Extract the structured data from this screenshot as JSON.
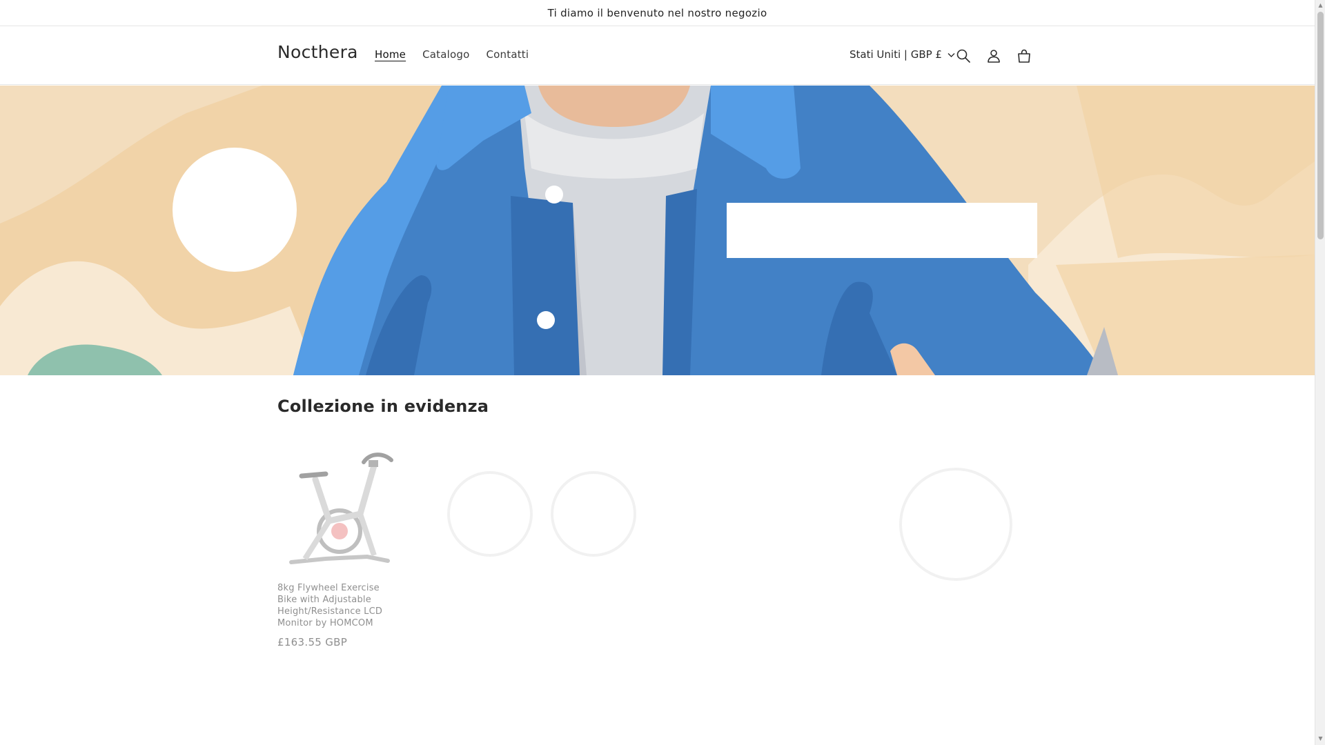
{
  "announcement": {
    "text": "Ti diamo il benvenuto nel nostro negozio"
  },
  "header": {
    "logo": "Nocthera",
    "nav": [
      {
        "label": "Home",
        "active": true
      },
      {
        "label": "Catalogo",
        "active": false
      },
      {
        "label": "Contatti",
        "active": false
      }
    ],
    "country_selector": "Stati Uniti | GBP £",
    "icons": [
      "search-icon",
      "account-icon",
      "cart-icon",
      "chevron-down-icon"
    ]
  },
  "hero": {
    "colors": {
      "background": "#f3ddbd",
      "jacket": "#4281c6",
      "jacket_light": "#559de6",
      "shirt": "#d5d8dd",
      "skin": "#e8bb9a"
    }
  },
  "collection": {
    "title": "Collezione in evidenza",
    "products": [
      {
        "title": "8kg Flywheel Exercise Bike with Adjustable Height/Resistance LCD Monitor by HOMCOM",
        "price": "£163.55 GBP"
      }
    ]
  },
  "colors": {
    "text": "#121212",
    "border": "#e6e6e6"
  }
}
